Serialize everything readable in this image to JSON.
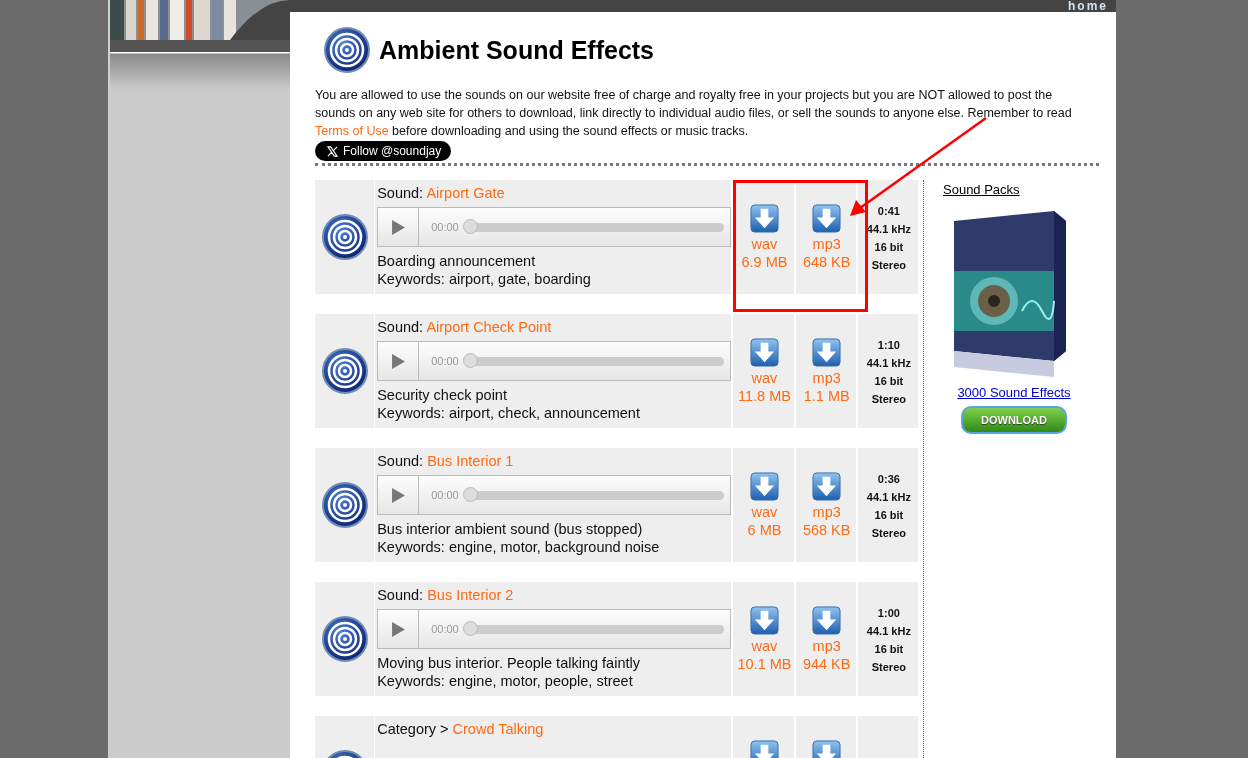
{
  "top_bar": {
    "home_link": "home"
  },
  "header": {
    "title": "Ambient Sound Effects"
  },
  "intro": {
    "text_before": "You are allowed to use the sounds on our website free of charge and royalty free in your projects but you are NOT allowed to post the sounds on any web site for others to download, link directly to individual audio files, or sell the sounds to anyone else. Remember to read ",
    "link": "Terms of Use",
    "text_after": " before downloading and using the sound effects or music tracks."
  },
  "follow_button": {
    "label": "Follow @soundjay"
  },
  "sounds": [
    {
      "kind": "sound",
      "prefix": "Sound:",
      "name": "Airport Gate",
      "time": "00:00",
      "description": "Boarding announcement",
      "keywords": "Keywords: airport, gate, boarding",
      "wav": {
        "format": "wav",
        "size": "6.9 MB"
      },
      "mp3": {
        "format": "mp3",
        "size": "648 KB"
      },
      "info": [
        "0:41",
        "44.1 kHz",
        "16 bit",
        "Stereo"
      ]
    },
    {
      "kind": "sound",
      "prefix": "Sound:",
      "name": "Airport Check Point",
      "time": "00:00",
      "description": "Security check point",
      "keywords": "Keywords: airport, check, announcement",
      "wav": {
        "format": "wav",
        "size": "11.8 MB"
      },
      "mp3": {
        "format": "mp3",
        "size": "1.1 MB"
      },
      "info": [
        "1:10",
        "44.1 kHz",
        "16 bit",
        "Stereo"
      ]
    },
    {
      "kind": "sound",
      "prefix": "Sound:",
      "name": "Bus Interior 1",
      "time": "00:00",
      "description": "Bus interior ambient sound (bus stopped)",
      "keywords": "Keywords: engine, motor, background noise",
      "wav": {
        "format": "wav",
        "size": "6 MB"
      },
      "mp3": {
        "format": "mp3",
        "size": "568 KB"
      },
      "info": [
        "0:36",
        "44.1 kHz",
        "16 bit",
        "Stereo"
      ]
    },
    {
      "kind": "sound",
      "prefix": "Sound:",
      "name": "Bus Interior 2",
      "time": "00:00",
      "description": "Moving bus interior. People talking faintly",
      "keywords": "Keywords: engine, motor, people, street",
      "wav": {
        "format": "wav",
        "size": "10.1 MB"
      },
      "mp3": {
        "format": "mp3",
        "size": "944 KB"
      },
      "info": [
        "1:00",
        "44.1 kHz",
        "16 bit",
        "Stereo"
      ]
    },
    {
      "kind": "category",
      "prefix": "Category >",
      "name": "Crowd Talking"
    }
  ],
  "sidebar": {
    "heading": "Sound Packs",
    "product_link": "3000 Sound Effects",
    "download_button": "DOWNLOAD"
  },
  "annotation": {
    "kind": "highlight"
  }
}
